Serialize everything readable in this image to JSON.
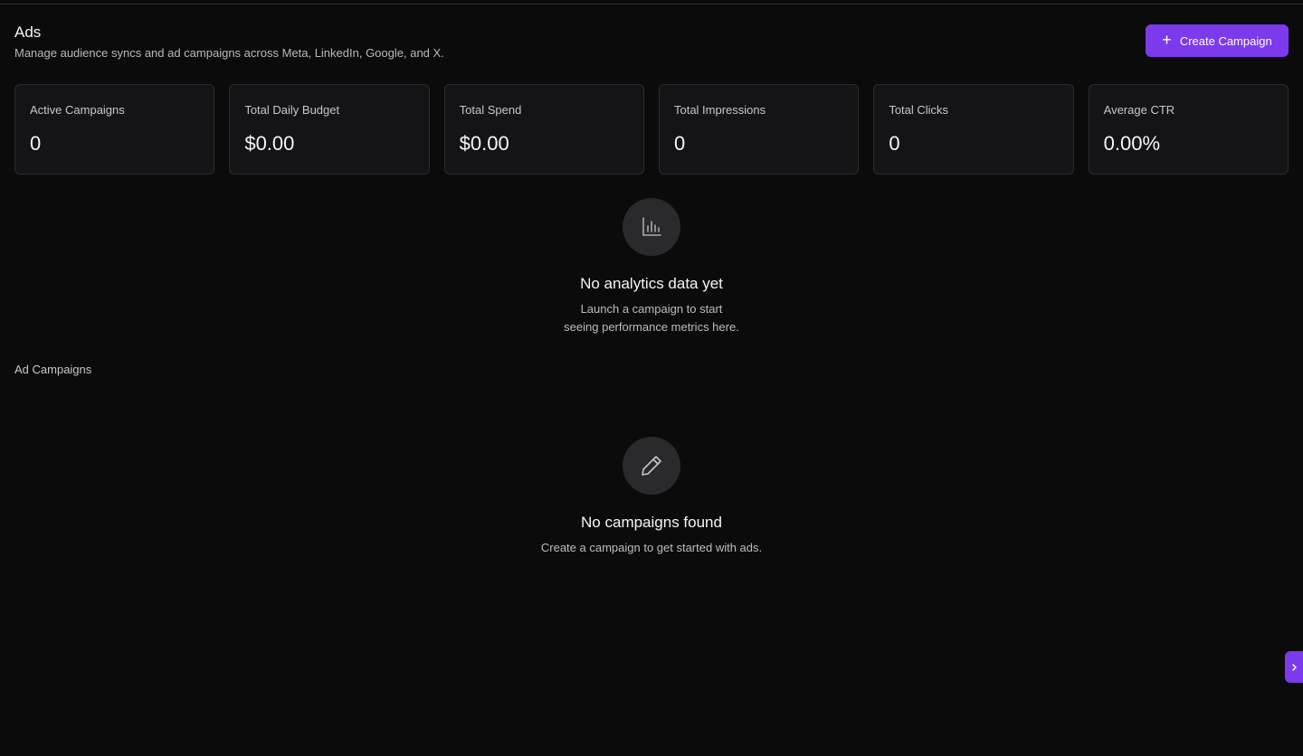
{
  "header": {
    "title": "Ads",
    "subtitle": "Manage audience syncs and ad campaigns across Meta, LinkedIn, Google, and X.",
    "create_button_label": "Create Campaign"
  },
  "stats": [
    {
      "label": "Active Campaigns",
      "value": "0"
    },
    {
      "label": "Total Daily Budget",
      "value": "$0.00"
    },
    {
      "label": "Total Spend",
      "value": "$0.00"
    },
    {
      "label": "Total Impressions",
      "value": "0"
    },
    {
      "label": "Total Clicks",
      "value": "0"
    },
    {
      "label": "Average CTR",
      "value": "0.00%"
    }
  ],
  "analytics_empty": {
    "icon": "bar-chart-icon",
    "title": "No analytics data yet",
    "line1": "Launch a campaign to start",
    "line2": "seeing performance metrics here."
  },
  "campaigns": {
    "section_label": "Ad Campaigns",
    "empty_icon": "pencil-icon",
    "empty_title": "No campaigns found",
    "empty_text": "Create a campaign to get started with ads."
  },
  "side_toggle": {
    "icon": "chevron-right-icon"
  },
  "colors": {
    "accent": "#7c3aed",
    "background": "#0b0b0c",
    "card": "#141416"
  }
}
